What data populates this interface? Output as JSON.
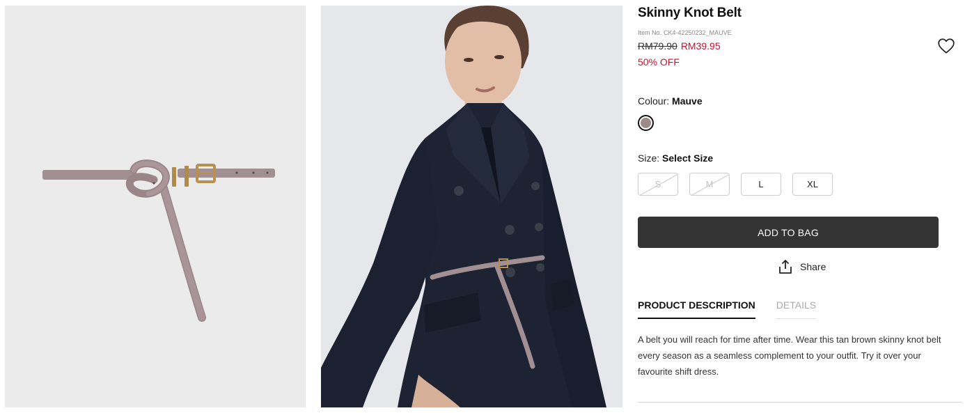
{
  "product": {
    "title": "Skinny Knot Belt",
    "item_no_label": "Item No.",
    "item_no": "CK4-42250232_MAUVE",
    "original_price": "RM79.90",
    "sale_price": "RM39.95",
    "discount": "50% OFF"
  },
  "images": [
    {
      "name": "belt-product-image"
    },
    {
      "name": "model-wearing-belt-image"
    }
  ],
  "colour": {
    "label": "Colour:",
    "selected": "Mauve",
    "swatch_color": "#9d8a8a"
  },
  "size": {
    "label": "Size:",
    "selected": "Select Size",
    "options": [
      {
        "label": "S",
        "available": false
      },
      {
        "label": "M",
        "available": false
      },
      {
        "label": "L",
        "available": true
      },
      {
        "label": "XL",
        "available": true
      }
    ]
  },
  "actions": {
    "add_to_bag": "ADD TO BAG",
    "share": "Share"
  },
  "tabs": [
    {
      "label": "PRODUCT DESCRIPTION",
      "active": true
    },
    {
      "label": "DETAILS",
      "active": false
    }
  ],
  "description": "A belt you will reach for time after time. Wear this tan brown skinny knot belt every season as a seamless complement to your outfit. Try it over your favourite shift dress.",
  "colors": {
    "sale": "#c8102e",
    "button_bg": "#343434",
    "belt": "#a28f93"
  },
  "icons": {
    "wishlist": "heart-outline-icon",
    "share": "share-upload-icon"
  }
}
